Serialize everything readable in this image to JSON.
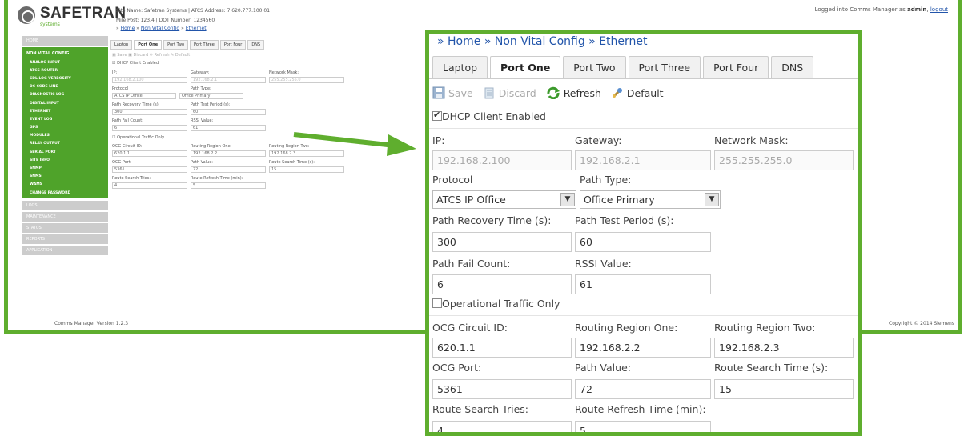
{
  "brand": {
    "name": "SAFETRAN",
    "sub": "systems"
  },
  "site_info": {
    "line1": "Site Name: Safetran Systems | ATCS Address: 7.620.777.100.01",
    "line2": "Mile Post:  123.4        | DOT Number:  1234560"
  },
  "logged_in": {
    "prefix": "Logged into Comms Manager as",
    "user": "admin",
    "logout": "logout"
  },
  "breadcrumb": {
    "home": "Home",
    "section": "Non Vital Config",
    "page": "Ethernet",
    "sep": "»"
  },
  "sidebar": {
    "home": "HOME",
    "group": "NON VITAL CONFIG",
    "items": [
      "ANALOG INPUT",
      "ATCS ROUTER",
      "CDL LOG VERBOSITY",
      "DC CODE LINE",
      "DIAGNOSTIC LOG",
      "DIGITAL INPUT",
      "ETHERNET",
      "EVENT LOG",
      "GPS",
      "MODULES",
      "RELAY OUTPUT",
      "SERIAL PORT",
      "SITE INFO",
      "SNMP",
      "SNMS",
      "WAMS",
      "CHANGE PASSWORD"
    ],
    "bottom": [
      "LOGS",
      "MAINTENANCE",
      "STATUS",
      "REPORTS",
      "APPLICATION"
    ]
  },
  "footer": {
    "left": "Comms Manager Version 1.2.3",
    "right": "Copyright © 2014 Siemens"
  },
  "tabs": [
    "Laptop",
    "Port One",
    "Port Two",
    "Port Three",
    "Port Four",
    "DNS"
  ],
  "selected_tab": "Port One",
  "toolbar": {
    "save": "Save",
    "discard": "Discard",
    "refresh": "Refresh",
    "default": "Default"
  },
  "form": {
    "dhcp_label": "DHCP Client Enabled",
    "ip_label": "IP:",
    "ip": "192.168.2.100",
    "gateway_label": "Gateway:",
    "gateway": "192.168.2.1",
    "netmask_label": "Network Mask:",
    "netmask": "255.255.255.0",
    "protocol_label": "Protocol",
    "protocol": "ATCS IP Office",
    "path_type_label": "Path Type:",
    "path_type": "Office Primary",
    "recovery_label": "Path Recovery Time (s):",
    "recovery": "300",
    "test_period_label": "Path Test Period (s):",
    "test_period": "60",
    "fail_count_label": "Path Fail Count:",
    "fail_count": "6",
    "rssi_label": "RSSI Value:",
    "rssi": "61",
    "op_traffic_label": "Operational Traffic Only",
    "ocg_circuit_label": "OCG Circuit ID:",
    "ocg_circuit": "620.1.1",
    "region_one_label": "Routing Region One:",
    "region_one": "192.168.2.2",
    "region_two_label": "Routing Region Two:",
    "region_two": "192.168.2.3",
    "ocg_port_label": "OCG Port:",
    "ocg_port": "5361",
    "path_value_label": "Path Value:",
    "path_value": "72",
    "search_time_label": "Route Search Time (s):",
    "search_time": "15",
    "search_tries_label": "Route Search Tries:",
    "search_tries": "4",
    "refresh_time_label": "Route Refresh Time (min):",
    "refresh_time": "5"
  },
  "colors": {
    "accent": "#5fae2e",
    "nav_green": "#4fa32a",
    "link": "#2255aa"
  }
}
